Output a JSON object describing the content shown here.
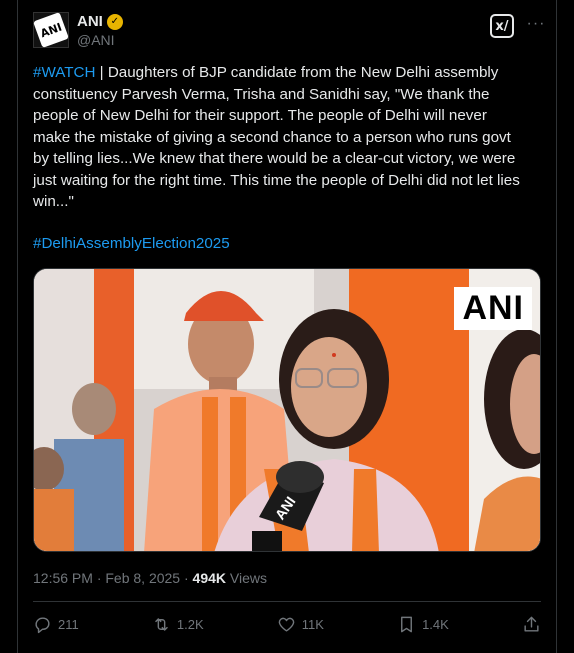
{
  "post": {
    "author_name": "ANI",
    "author_handle": "@ANI",
    "avatar_label": "ANI",
    "watch_tag": "#WATCH",
    "body": " | Daughters of BJP candidate from the New Delhi assembly constituency Parvesh Verma, Trisha and Sanidhi say, \"We thank the people of New Delhi for their support. The people of Delhi will never make the mistake of giving a second chance to a person who runs govt by telling lies...We knew that there would be a clear-cut victory, we were just waiting for the right time. This time the people of Delhi did not let lies win...\"",
    "hashtag": "#DelhiAssemblyElection2025",
    "media_watermark": "ANI",
    "mic_label": "ANI",
    "time": "12:56 PM · Feb 8, 2025 · ",
    "views_count": "494K",
    "views_label": " Views"
  },
  "actions": {
    "replies": "211",
    "reposts": "1.2K",
    "likes": "11K",
    "bookmarks": "1.4K"
  },
  "colors": {
    "accent": "#1d9bf0",
    "verified": "#e8b400",
    "muted": "#71767b"
  }
}
